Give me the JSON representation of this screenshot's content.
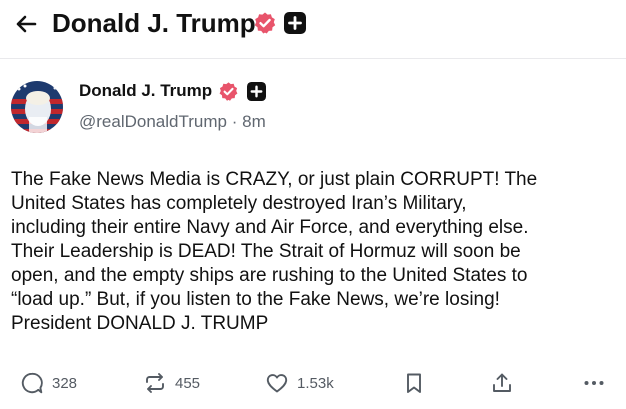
{
  "header": {
    "title": "Donald J. Trump"
  },
  "post": {
    "author_name": "Donald J. Trump",
    "handle": "@realDonaldTrump",
    "separator": "·",
    "time_ago": "8m",
    "lines": [
      "The Fake News Media is CRAZY, or just plain CORRUPT! The",
      "United States has completely destroyed Iran’s Military,",
      "including their entire Navy and Air Force, and everything else.",
      "Their Leadership is DEAD! The Strait of Hormuz will soon be",
      "open, and the empty ships are rushing to the United States to",
      "“load up.” But, if you listen to the Fake News, we’re losing!",
      "President DONALD J. TRUMP"
    ]
  },
  "actions": {
    "replies": "328",
    "reposts": "455",
    "likes": "1.53k"
  },
  "colors": {
    "verified_badge": "#e8546b",
    "text": "#111111",
    "muted": "#606770"
  },
  "icons": [
    "back-arrow-icon",
    "verified-badge-icon",
    "plus-box-icon",
    "reply-icon",
    "repost-icon",
    "like-icon",
    "bookmark-icon",
    "share-icon",
    "more-icon"
  ]
}
